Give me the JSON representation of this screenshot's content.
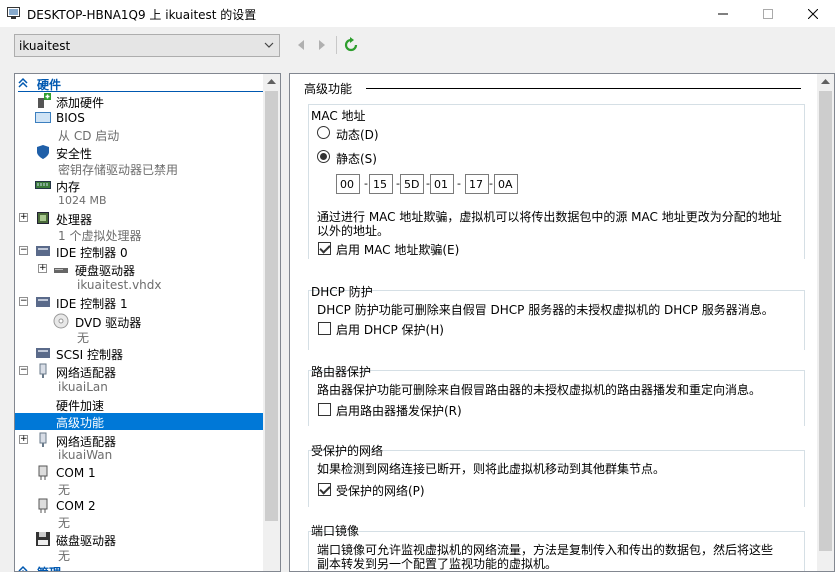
{
  "window": {
    "title": "DESKTOP-HBNA1Q9 上 ikuaitest 的设置",
    "minimize": "—",
    "maximize": "☐",
    "close": "✕"
  },
  "toolbar": {
    "vm_name": "ikuaitest"
  },
  "tree": {
    "hardware_header": "硬件",
    "items": [
      {
        "label": "添加硬件"
      },
      {
        "label": "BIOS",
        "sub": "从 CD 启动"
      },
      {
        "label": "安全性",
        "sub": "密钥存储驱动器已禁用"
      },
      {
        "label": "内存",
        "sub": "1024 MB"
      },
      {
        "label": "处理器",
        "sub": "1 个虚拟处理器"
      },
      {
        "label": "IDE 控制器 0"
      },
      {
        "label": "硬盘驱动器",
        "sub": "ikuaitest.vhdx"
      },
      {
        "label": "IDE 控制器 1"
      },
      {
        "label": "DVD 驱动器",
        "sub": "无"
      },
      {
        "label": "SCSI 控制器"
      },
      {
        "label": "网络适配器",
        "sub": "ikuaiLan"
      },
      {
        "label": "硬件加速"
      },
      {
        "label": "高级功能"
      },
      {
        "label": "网络适配器",
        "sub": "ikuaiWan"
      },
      {
        "label": "COM 1",
        "sub": "无"
      },
      {
        "label": "COM 2",
        "sub": "无"
      },
      {
        "label": "磁盘驱动器",
        "sub": "无"
      }
    ],
    "management_header": "管理"
  },
  "main": {
    "group_title": "高级功能",
    "mac": {
      "title": "MAC 地址",
      "dynamic_label": "动态(D)",
      "static_label": "静态(S)",
      "octets": [
        "00",
        "15",
        "5D",
        "01",
        "17",
        "0A"
      ],
      "spoof_desc_1": "通过进行 MAC 地址欺骗，虚拟机可以将传出数据包中的源 MAC 地址更改为分配的地址",
      "spoof_desc_2": "以外的地址。",
      "spoof_label": "启用 MAC 地址欺骗(E)"
    },
    "dhcp": {
      "title": "DHCP 防护",
      "desc": "DHCP 防护功能可删除来自假冒 DHCP 服务器的未授权虚拟机的 DHCP 服务器消息。",
      "label": "启用 DHCP 保护(H)"
    },
    "router": {
      "title": "路由器保护",
      "desc": "路由器保护功能可删除来自假冒路由器的未授权虚拟机的路由器播发和重定向消息。",
      "label": "启用路由器播发保护(R)"
    },
    "protected": {
      "title": "受保护的网络",
      "desc": "如果检测到网络连接已断开，则将此虚拟机移动到其他群集节点。",
      "label": "受保护的网络(P)"
    },
    "mirror": {
      "title": "端口镜像",
      "desc_1": "端口镜像可允许监视虚拟机的网络流量，方法是复制传入和传出的数据包，然后将这些",
      "desc_2": "副本转发到另一个配置了监视功能的虚拟机。"
    }
  },
  "colors": {
    "selection": "#0078d7",
    "header_blue": "#0058b0",
    "green_refresh": "#2e9e2e"
  }
}
